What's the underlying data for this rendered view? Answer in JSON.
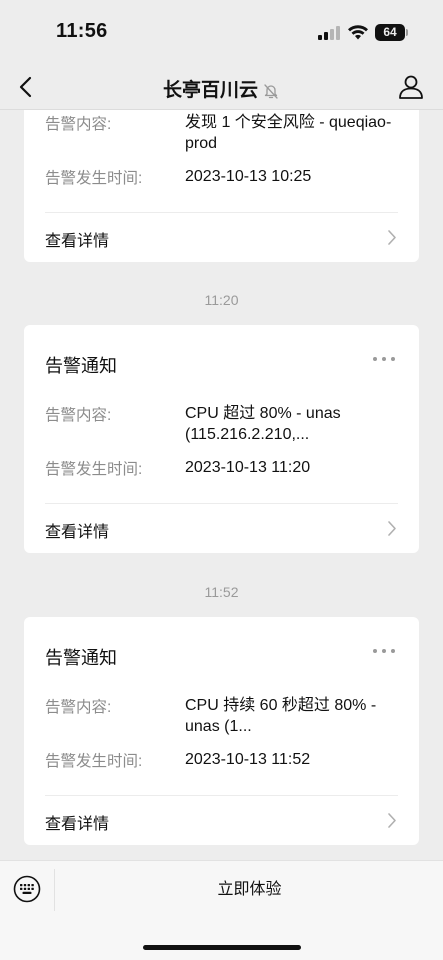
{
  "status_bar": {
    "time": "11:56",
    "battery": "64"
  },
  "nav": {
    "title": "长亭百川云",
    "back_icon": "chevron-left-icon",
    "profile_icon": "person-icon",
    "mute_icon": "bell-slash-icon"
  },
  "messages": [
    {
      "title": "",
      "content_label": "告警内容:",
      "content_value": "发现 1 个安全风险 - queqiao-prod",
      "time_label": "告警发生时间:",
      "time_value": "2023-10-13 10:25",
      "detail_label": "查看详情"
    },
    {
      "timestamp": "11:20",
      "title": "告警通知",
      "content_label": "告警内容:",
      "content_value": "CPU 超过 80% - unas (115.216.2.210,...",
      "time_label": "告警发生时间:",
      "time_value": "2023-10-13 11:20",
      "detail_label": "查看详情"
    },
    {
      "timestamp": "11:52",
      "title": "告警通知",
      "content_label": "告警内容:",
      "content_value": "CPU 持续 60 秒超过 80% - unas (1...",
      "time_label": "告警发生时间:",
      "time_value": "2023-10-13 11:52",
      "detail_label": "查看详情"
    }
  ],
  "bottom_bar": {
    "menu_label": "立即体验",
    "keyboard_icon": "keyboard-icon"
  }
}
